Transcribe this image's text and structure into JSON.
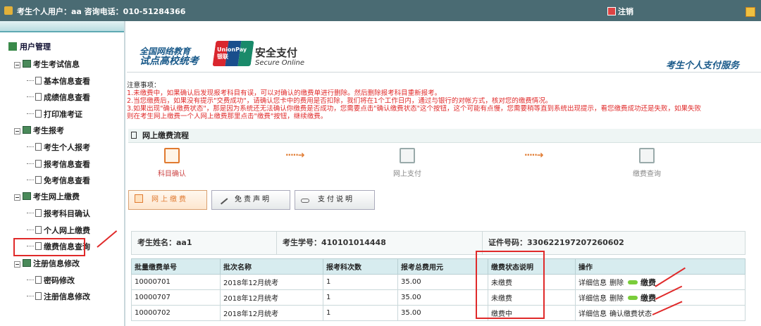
{
  "topbar": {
    "user_info": "考生个人用户：aa 咨询电话：010-51284366",
    "logout_label": "注销"
  },
  "sidebar": {
    "header": "用户管理",
    "groups": [
      {
        "label": "考生考试信息",
        "items": [
          "基本信息查看",
          "成绩信息查看",
          "打印准考证"
        ]
      },
      {
        "label": "考生报考",
        "items": [
          "考生个人报考",
          "报考信息查看",
          "免考信息查看"
        ]
      },
      {
        "label": "考生网上缴费",
        "items": [
          "报考科目确认",
          "个人网上缴费",
          "缴费信息查询"
        ]
      },
      {
        "label": "注册信息修改",
        "items": [
          "密码修改",
          "注册信息修改"
        ]
      }
    ]
  },
  "banner": {
    "title_line1": "全国网络教育",
    "title_line2": "试点高校统考",
    "unionpay_text": "UnionPay 银联",
    "secure_cn": "安全支付",
    "secure_en": "Secure Online",
    "right_title": "考生个人支付服务"
  },
  "notice": {
    "heading": "注意事项：",
    "lines": [
      "1.未缴费中，如果确认后发现报考科目有误，可以对确认的缴费单进行删除。然后删除报考科目重新报考。",
      "2.当您缴费后，如果没有提示\"交费成功\"，请确认您卡中的费用是否扣除，我们将在1个工作日内，通过与银行的对帐方式，核对您的缴费情况。",
      "3.如果出现\"确认缴费状态\"，那是因为系统还无法确认你缴费是否成功，您需要点击\"确认缴费状态\"这个按钮，这个可能有点慢，您需要稍等直到系统出现提示，看您缴费成功还是失败，如果失败",
      "则在考生网上缴费一个人网上缴费那里点击\"缴费\"按钮，继续缴费。"
    ]
  },
  "flow": {
    "title": "网上缴费流程",
    "steps": [
      "科目确认",
      "网上支付",
      "缴费查询"
    ]
  },
  "buttons": {
    "pay": "网上缴费",
    "disclaimer": "免责声明",
    "payment_info": "支付说明"
  },
  "student": {
    "name": "考生姓名：aa1",
    "id": "考生学号：410101014448",
    "cert": "证件号码：330622197207260602"
  },
  "table": {
    "headers": [
      "批量缴费单号",
      "批次名称",
      "报考科次数",
      "报考总费用元",
      "缴费状态说明",
      "操作"
    ],
    "rows": [
      {
        "no": "10000701",
        "batch": "2018年12月统考",
        "count": "1",
        "fee": "35.00",
        "status": "未缴费",
        "op1": "详细信息",
        "op2": "删除",
        "op3": "缴费"
      },
      {
        "no": "10000707",
        "batch": "2018年12月统考",
        "count": "1",
        "fee": "35.00",
        "status": "未缴费",
        "op1": "详细信息",
        "op2": "删除",
        "op3": "缴费"
      },
      {
        "no": "10000702",
        "batch": "2018年12月统考",
        "count": "1",
        "fee": "35.00",
        "status": "缴费中",
        "op1": "详细信息",
        "op2": "",
        "op3": "确认缴费状态"
      }
    ]
  },
  "colors": {
    "topbar": "#4a6b73",
    "annotation_red": "#e02a2a",
    "accent_orange": "#e07a30",
    "notice_red": "#e02a2a",
    "table_header": "#d7ecef"
  }
}
